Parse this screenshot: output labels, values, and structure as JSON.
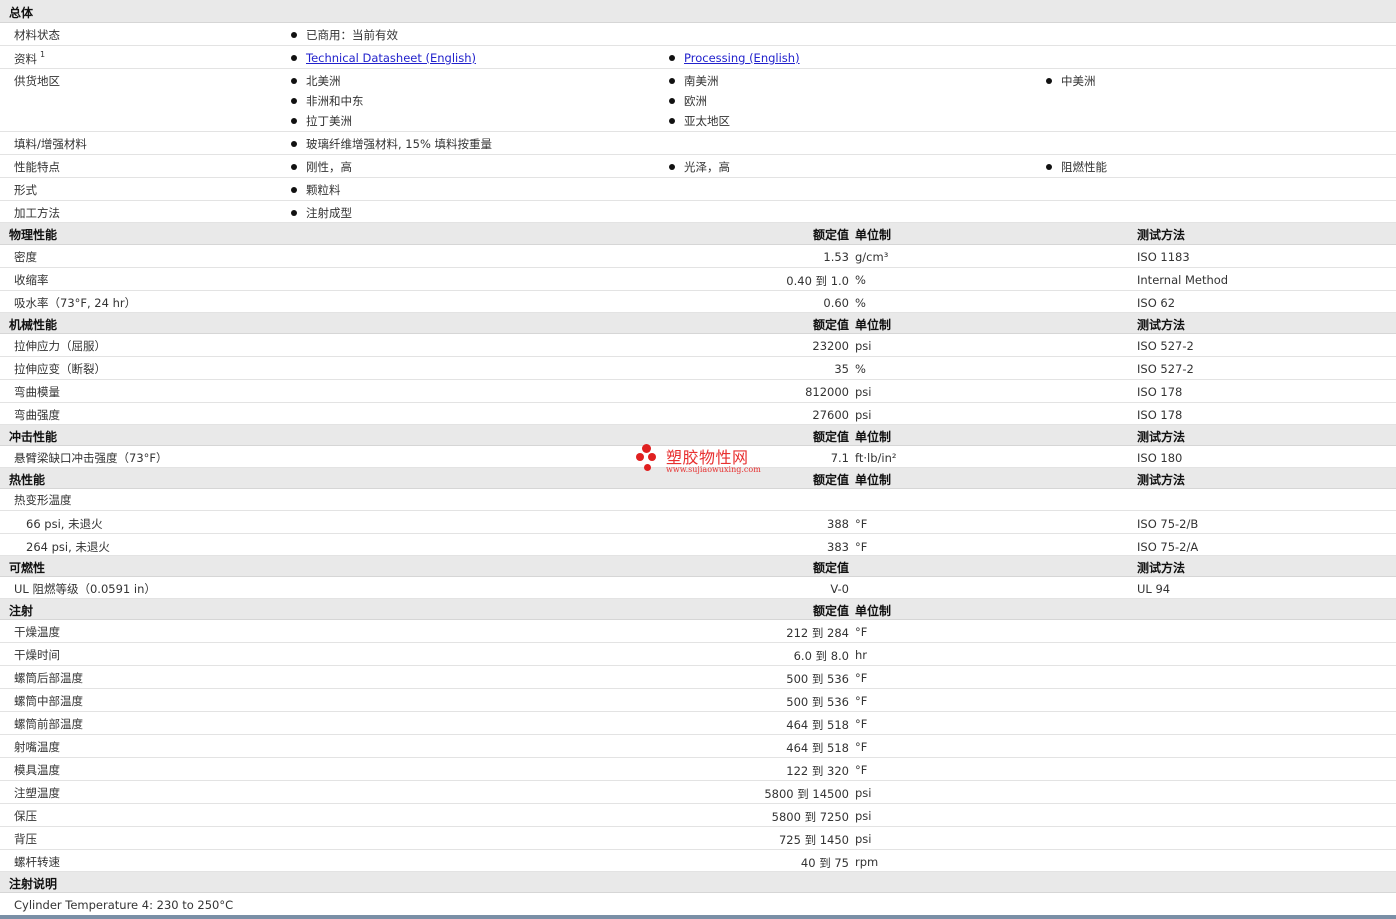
{
  "general": {
    "title": "总体",
    "status_label": "材料状态",
    "status_value": "已商用：当前有效",
    "docs_label": "资料",
    "docs_sup": "1",
    "doc1": "Technical Datasheet (English)",
    "doc2": "Processing (English)",
    "regions_label": "供货地区",
    "regions": [
      "北美洲",
      "南美洲",
      "中美洲",
      "非洲和中东",
      "欧洲",
      "拉丁美洲",
      "亚太地区"
    ],
    "filler_label": "填料/增强材料",
    "filler_value": "玻璃纤维增强材料, 15% 填料按重量",
    "features_label": "性能特点",
    "features": [
      "刚性，高",
      "光泽，高",
      "阻燃性能"
    ],
    "form_label": "形式",
    "form_value": "颗粒料",
    "process_label": "加工方法",
    "process_value": "注射成型"
  },
  "headers": {
    "nominal": "额定值",
    "unit": "单位制",
    "test": "测试方法"
  },
  "physical": {
    "title": "物理性能",
    "rows": [
      {
        "label": "密度",
        "value": "1.53",
        "unit": "g/cm³",
        "test": "ISO 1183"
      },
      {
        "label": "收缩率",
        "value": "0.40 到  1.0",
        "unit": "%",
        "test": "Internal Method"
      },
      {
        "label": "吸水率（73°F, 24 hr）",
        "value": "0.60",
        "unit": "%",
        "test": "ISO 62"
      }
    ]
  },
  "mechanical": {
    "title": "机械性能",
    "rows": [
      {
        "label": "拉伸应力（屈服）",
        "value": "23200",
        "unit": "psi",
        "test": "ISO 527-2"
      },
      {
        "label": "拉伸应变（断裂）",
        "value": "35",
        "unit": "%",
        "test": "ISO 527-2"
      },
      {
        "label": "弯曲模量",
        "value": "812000",
        "unit": "psi",
        "test": "ISO 178"
      },
      {
        "label": "弯曲强度",
        "value": "27600",
        "unit": "psi",
        "test": "ISO 178"
      }
    ]
  },
  "impact": {
    "title": "冲击性能",
    "rows": [
      {
        "label": "悬臂梁缺口冲击强度（73°F）",
        "value": "7.1",
        "unit": "ft·lb/in²",
        "test": "ISO 180"
      }
    ]
  },
  "thermal": {
    "title": "热性能",
    "group_label": "热变形温度",
    "rows": [
      {
        "label": "66 psi, 未退火",
        "value": "388",
        "unit": "°F",
        "test": "ISO 75-2/B"
      },
      {
        "label": "264 psi, 未退火",
        "value": "383",
        "unit": "°F",
        "test": "ISO 75-2/A"
      }
    ]
  },
  "flammability": {
    "title": "可燃性",
    "rows": [
      {
        "label": "UL 阻燃等级（0.0591 in）",
        "value": "V-0",
        "unit": "",
        "test": "UL 94"
      }
    ]
  },
  "injection": {
    "title": "注射",
    "rows": [
      {
        "label": "干燥温度",
        "value": "212 到  284",
        "unit": "°F"
      },
      {
        "label": "干燥时间",
        "value": "6.0 到  8.0",
        "unit": "hr"
      },
      {
        "label": "螺筒后部温度",
        "value": "500 到  536",
        "unit": "°F"
      },
      {
        "label": "螺筒中部温度",
        "value": "500 到  536",
        "unit": "°F"
      },
      {
        "label": "螺筒前部温度",
        "value": "464 到  518",
        "unit": "°F"
      },
      {
        "label": "射嘴温度",
        "value": "464 到  518",
        "unit": "°F"
      },
      {
        "label": "模具温度",
        "value": "122 到  320",
        "unit": "°F"
      },
      {
        "label": "注塑温度",
        "value": "5800 到  14500",
        "unit": "psi"
      },
      {
        "label": "保压",
        "value": "5800 到  7250",
        "unit": "psi"
      },
      {
        "label": "背压",
        "value": "725 到  1450",
        "unit": "psi"
      },
      {
        "label": "螺杆转速",
        "value": "40 到  75",
        "unit": "rpm"
      }
    ]
  },
  "notes": {
    "title": "注射说明",
    "text": "Cylinder Temperature 4: 230 to 250°C"
  },
  "watermark": {
    "name": "塑胶物性网",
    "url": "www.sujiaowuxing.com",
    "color": "#e02020"
  }
}
